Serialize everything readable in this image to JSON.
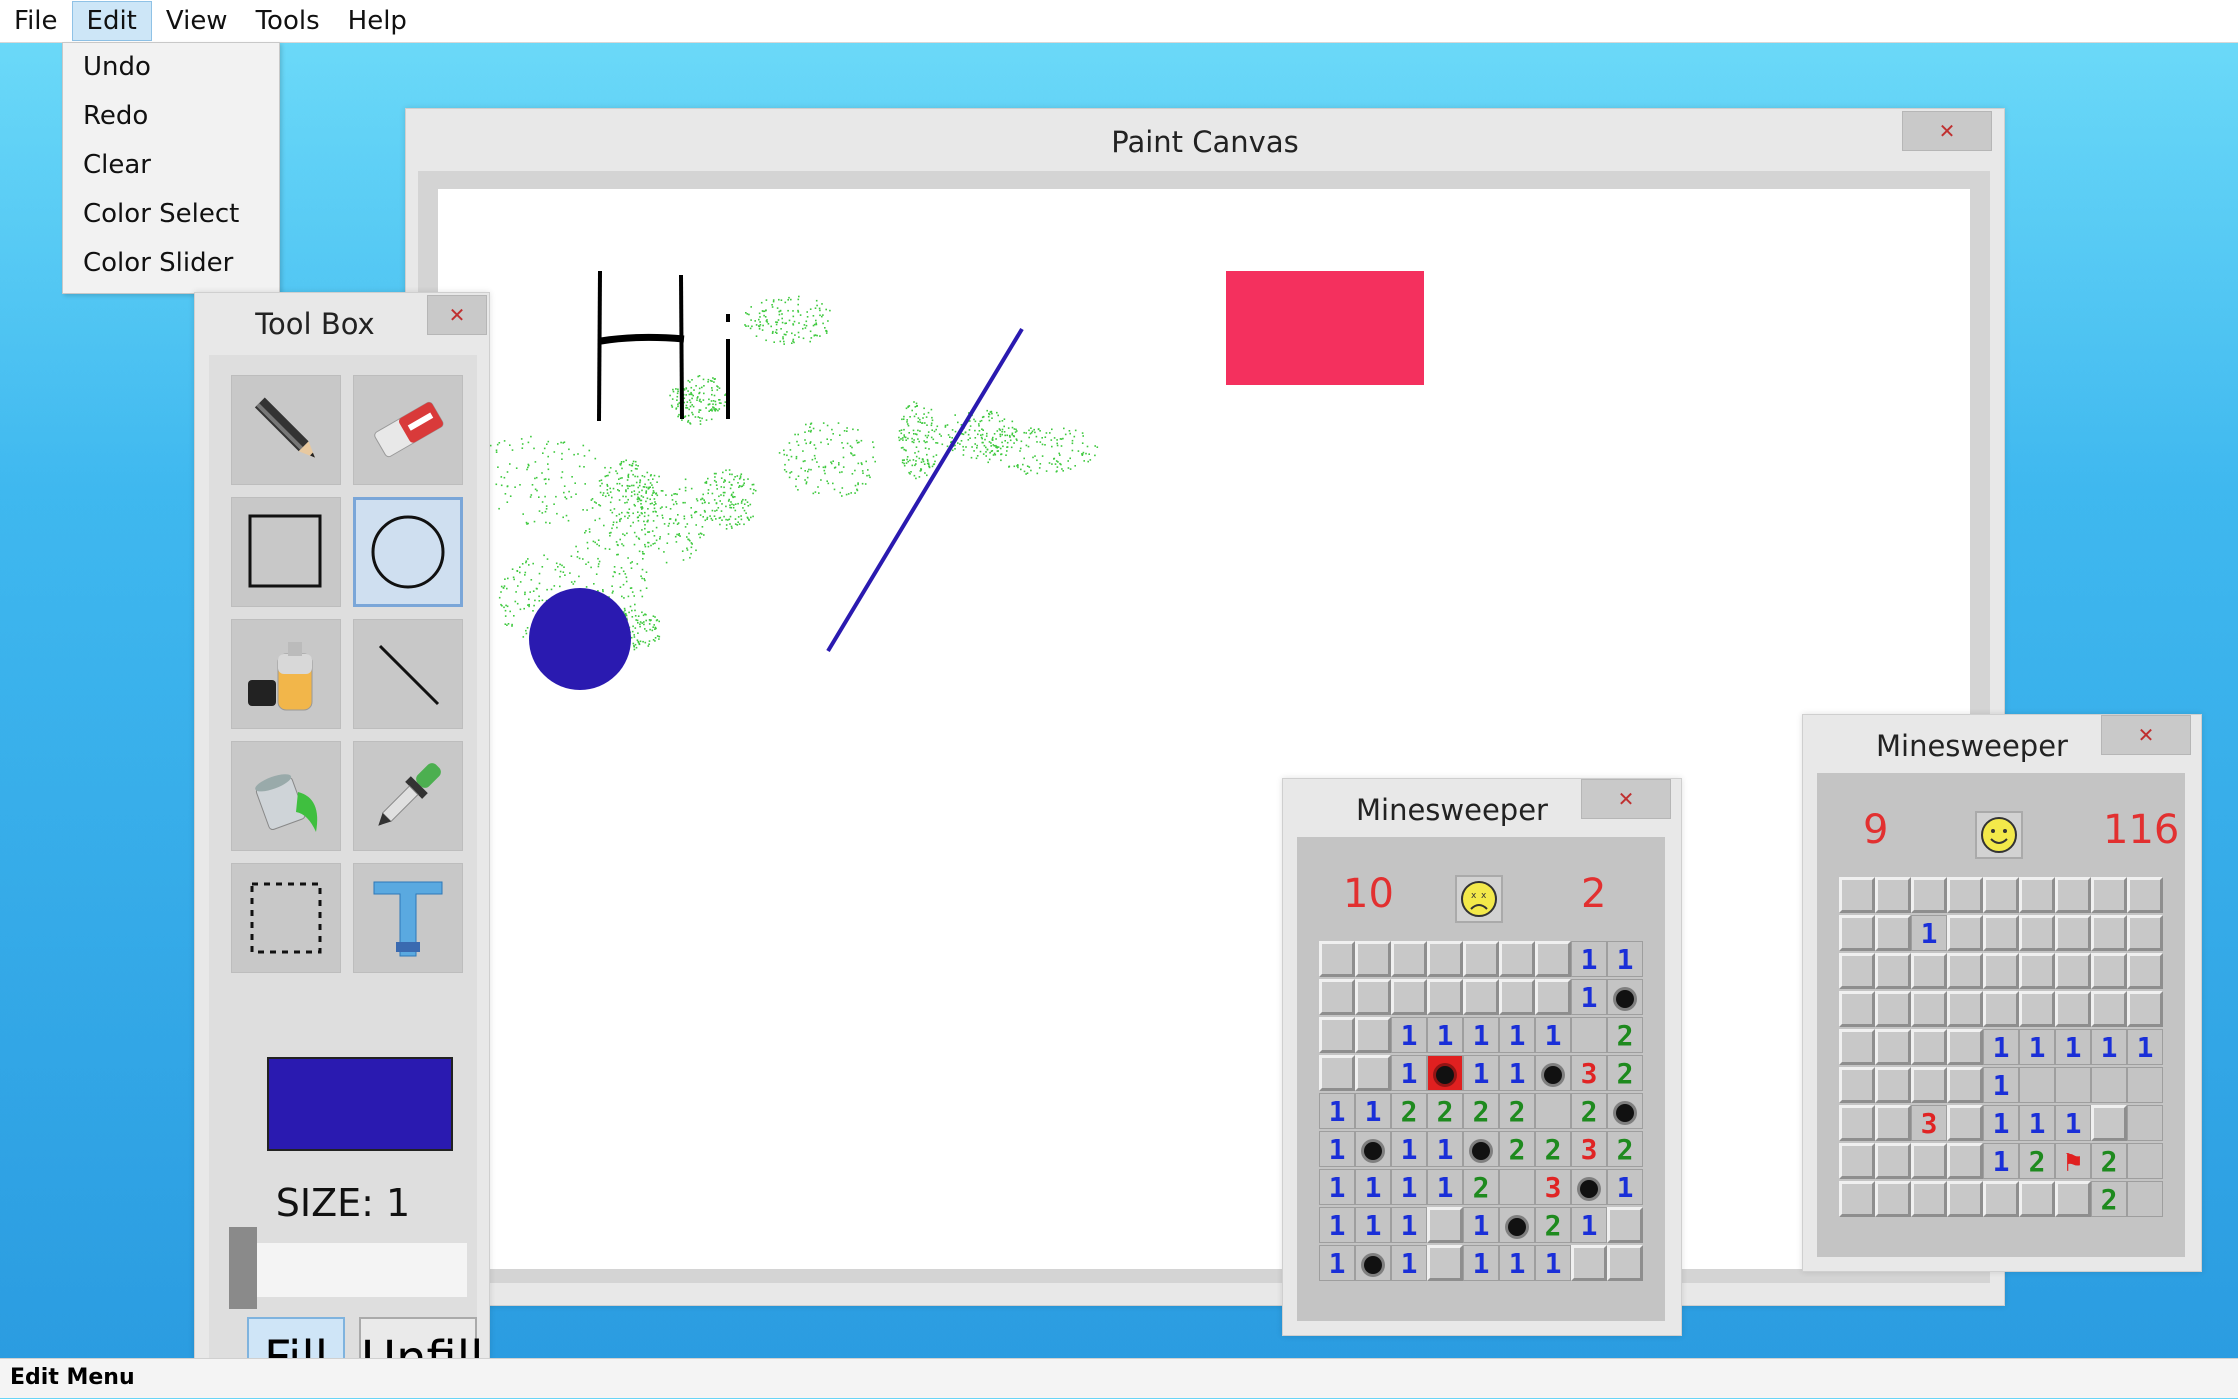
{
  "menubar": {
    "items": [
      "File",
      "Edit",
      "View",
      "Tools",
      "Help"
    ],
    "active": "Edit"
  },
  "edit_menu": {
    "items": [
      "Undo",
      "Redo",
      "Clear",
      "Color Select",
      "Color Slider"
    ]
  },
  "status_bar": {
    "text": "Edit Menu"
  },
  "paint_window": {
    "title": "Paint Canvas",
    "close_glyph": "✕",
    "canvas_text": "Hi",
    "colors": {
      "rect": "#f4305e",
      "circle": "#2a1ab0",
      "line": "#2a1ab0",
      "spray": "#3ec93e",
      "text": "#000000"
    }
  },
  "toolbox": {
    "title": "Tool Box",
    "close_glyph": "✕",
    "tools": [
      "pencil-icon",
      "eraser-icon",
      "rectangle-icon",
      "ellipse-icon",
      "spray-can-icon",
      "line-icon",
      "paint-bucket-icon",
      "eyedropper-icon",
      "select-icon",
      "text-icon"
    ],
    "selected_tool": "ellipse-icon",
    "current_color": "#2a1ab0",
    "size_label": "SIZE: 1",
    "size_value": 1,
    "fill_label": "Fill",
    "unfill_label": "Unfill"
  },
  "minesweeper_1": {
    "title": "Minesweeper",
    "close_glyph": "✕",
    "left_counter": "10",
    "right_counter": "2",
    "face": "sad",
    "grid": [
      "HHHHHHH11",
      "HHHHHHH1M",
      "HH11111 21",
      "HH1X11M32",
      "112222 2MM",
      "1M11M2232",
      "11112 3M1H",
      "111H1M21H",
      "1M1H111HH"
    ]
  },
  "minesweeper_2": {
    "title": "Minesweeper",
    "close_glyph": "✕",
    "left_counter": "9",
    "right_counter": "116",
    "face": "happy",
    "grid": [
      "HHHHHHHHH",
      "HH1HHHHHH",
      "HHHHHHHHH",
      "HHHHHHHHH",
      "HHHH11111",
      "HHHH1....",
      "HH3H111H.",
      "HHHH12F2.",
      "HHHHHHH2."
    ]
  }
}
